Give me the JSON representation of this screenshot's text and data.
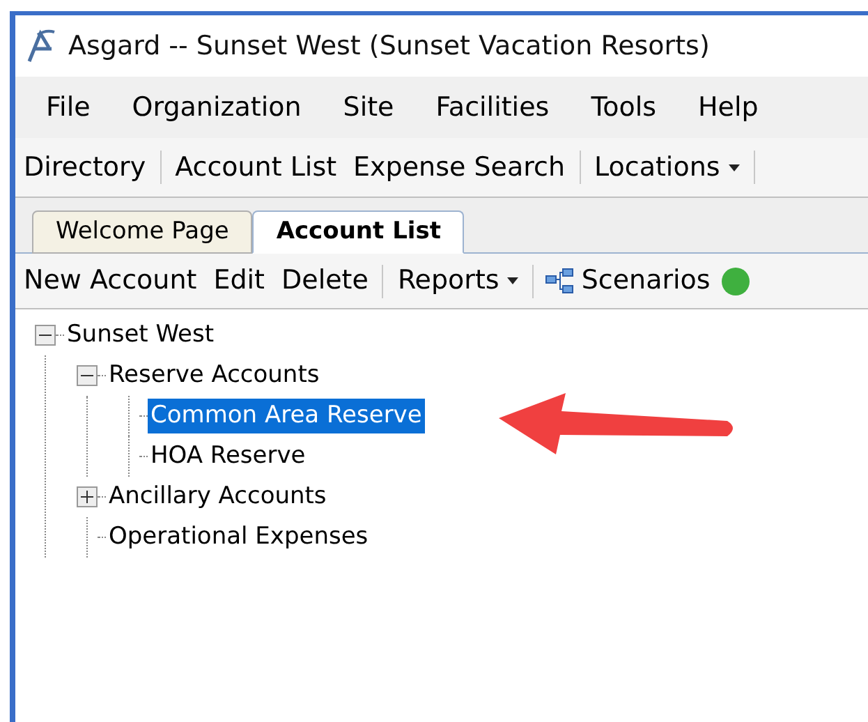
{
  "window": {
    "title": "Asgard -- Sunset West (Sunset Vacation Resorts)"
  },
  "menu": [
    "File",
    "Organization",
    "Site",
    "Facilities",
    "Tools",
    "Help"
  ],
  "toolbar": [
    {
      "label": "Directory",
      "kind": "button"
    },
    {
      "label": "Account List",
      "kind": "button"
    },
    {
      "label": "Expense Search",
      "kind": "button"
    },
    {
      "label": "Locations",
      "kind": "dropdown"
    }
  ],
  "tabs": [
    {
      "label": "Welcome Page",
      "selected": false
    },
    {
      "label": "Account List",
      "selected": true
    }
  ],
  "actions": [
    {
      "label": "New Account",
      "kind": "button"
    },
    {
      "label": "Edit",
      "kind": "button"
    },
    {
      "label": "Delete",
      "kind": "button"
    },
    {
      "label": "Reports",
      "kind": "dropdown"
    },
    {
      "label": "Scenarios",
      "kind": "icon-button"
    }
  ],
  "tree": [
    {
      "label": "Sunset West",
      "expanded": true,
      "selected": false,
      "children": [
        {
          "label": "Reserve Accounts",
          "expanded": true,
          "selected": false,
          "children": [
            {
              "label": "Common Area Reserve",
              "selected": true
            },
            {
              "label": "HOA Reserve",
              "selected": false
            }
          ]
        },
        {
          "label": "Ancillary Accounts",
          "expanded": false,
          "selected": false
        },
        {
          "label": "Operational Expenses",
          "selected": false
        }
      ]
    }
  ]
}
